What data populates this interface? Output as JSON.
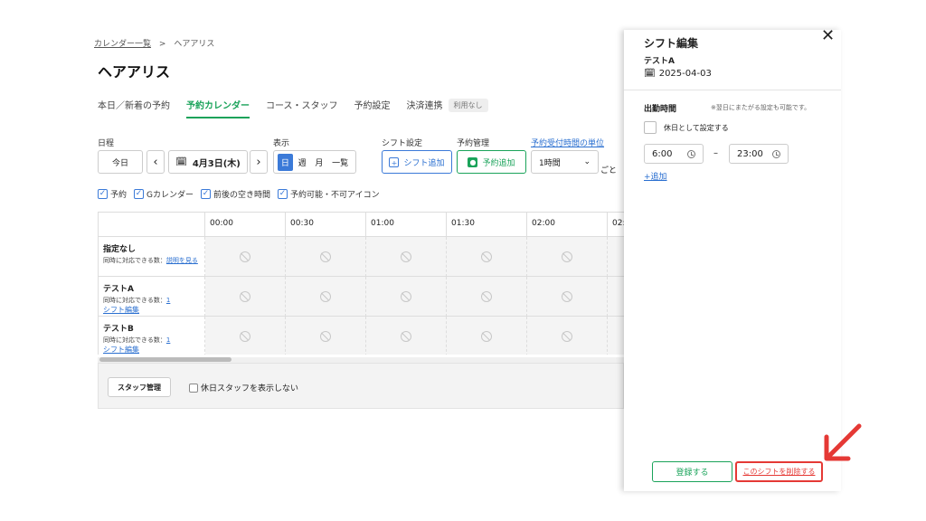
{
  "breadcrumb": {
    "parent": "カレンダー一覧",
    "sep": ">",
    "current": "ヘアアリス"
  },
  "page_title": "ヘアアリス",
  "tabs": [
    {
      "label": "本日／新着の予約"
    },
    {
      "label": "予約カレンダー"
    },
    {
      "label": "コース・スタッフ"
    },
    {
      "label": "予約設定"
    },
    {
      "label": "決済連携"
    }
  ],
  "tab_badge": "利用なし",
  "controls": {
    "date_label": "日程",
    "today": "今日",
    "prev": "‹",
    "next": "›",
    "date": "4月3日(木)",
    "view_label": "表示",
    "views": [
      "日",
      "週",
      "月",
      "一覧"
    ],
    "shift_label": "シフト設定",
    "shift_add": "シフト追加",
    "resv_label": "予約管理",
    "resv_add": "予約追加",
    "unit_label": "予約受付時間の単位",
    "unit_value": "1時間",
    "unit_suffix": "ごと"
  },
  "filters": [
    "予約",
    "Gカレンダー",
    "前後の空き時間",
    "予約可能・不可アイコン"
  ],
  "grid": {
    "times": [
      "00:00",
      "00:30",
      "01:00",
      "01:30",
      "02:00",
      "02:"
    ],
    "rows": [
      {
        "name": "指定なし",
        "sub": "同時に対応できる数：",
        "link": "説明を見る",
        "edit": ""
      },
      {
        "name": "テストA",
        "sub": "同時に対応できる数：",
        "link": "1",
        "edit": "シフト編集"
      },
      {
        "name": "テストB",
        "sub": "同時に対応できる数：",
        "link": "1",
        "edit": "シフト編集"
      }
    ]
  },
  "footer": {
    "staff_button": "スタッフ管理",
    "hide_holiday": "休日スタッフを表示しない"
  },
  "panel": {
    "title": "シフト編集",
    "close": "✕",
    "staff": "テストA",
    "date": "2025-04-03",
    "work_time_label": "出勤時間",
    "note": "※翌日にまたがる設定も可能です。",
    "holiday": "休日として設定する",
    "start": "6:00",
    "dash": "–",
    "end": "23:00",
    "add": "+追加",
    "register": "登録する",
    "delete": "このシフトを削除する"
  },
  "colors": {
    "accent_green": "#1aa35a",
    "accent_blue": "#3b7ad8",
    "highlight_red": "#e53935"
  }
}
